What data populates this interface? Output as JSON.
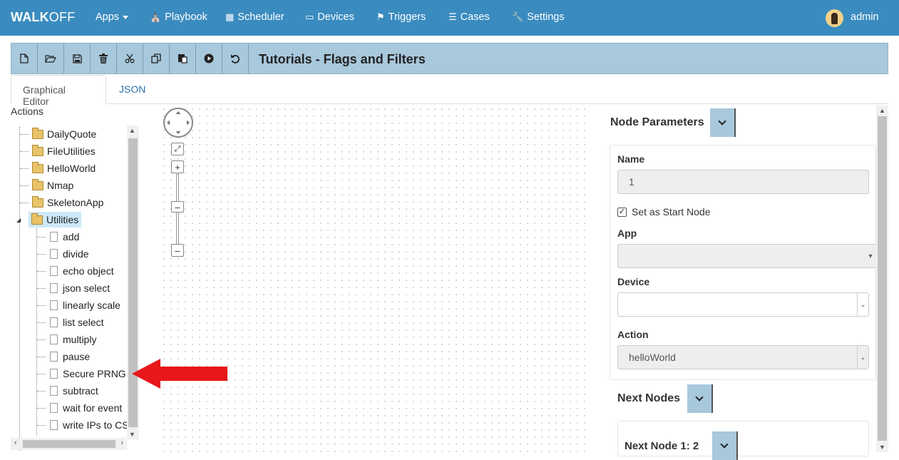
{
  "navbar": {
    "brand_bold": "WALK",
    "brand_rest": "OFF",
    "items": [
      {
        "label": "Apps",
        "icon": "caret-down-icon"
      },
      {
        "label": "Playbook",
        "icon": "sitemap-icon"
      },
      {
        "label": "Scheduler",
        "icon": "calendar-icon"
      },
      {
        "label": "Devices",
        "icon": "monitor-icon"
      },
      {
        "label": "Triggers",
        "icon": "flag-icon"
      },
      {
        "label": "Cases",
        "icon": "list-icon"
      },
      {
        "label": "Settings",
        "icon": "wrench-icon"
      }
    ],
    "user": "admin"
  },
  "toolbar": {
    "buttons": [
      {
        "name": "new",
        "icon": "new-file-icon"
      },
      {
        "name": "open",
        "icon": "folder-open-icon"
      },
      {
        "name": "save",
        "icon": "save-icon"
      },
      {
        "name": "delete",
        "icon": "trash-icon"
      },
      {
        "name": "cut",
        "icon": "scissors-icon"
      },
      {
        "name": "copy",
        "icon": "copy-icon"
      },
      {
        "name": "paste",
        "icon": "paste-icon"
      },
      {
        "name": "execute",
        "icon": "play-icon"
      },
      {
        "name": "undo",
        "icon": "undo-icon"
      }
    ],
    "title": "Tutorials - Flags and Filters"
  },
  "tabs": [
    {
      "label": "Graphical Editor",
      "active": true
    },
    {
      "label": "JSON",
      "active": false
    }
  ],
  "actions": {
    "label": "Actions",
    "apps": [
      "DailyQuote",
      "FileUtilities",
      "HelloWorld",
      "Nmap",
      "SkeletonApp",
      "Utilities"
    ],
    "selected_app": "Utilities",
    "utilities_actions": [
      "add",
      "divide",
      "echo object",
      "json select",
      "linearly scale",
      "list select",
      "multiply",
      "pause",
      "Secure PRNG",
      "subtract",
      "wait for event",
      "write IPs to CS"
    ]
  },
  "node_parameters": {
    "title": "Node Parameters",
    "name_label": "Name",
    "name_value": "1",
    "start_node_label": "Set as Start Node",
    "start_node_checked": true,
    "app_label": "App",
    "app_value": "",
    "device_label": "Device",
    "device_value": "",
    "action_label": "Action",
    "action_value": "helloWorld"
  },
  "next_nodes": {
    "title": "Next Nodes",
    "first_label": "Next Node 1: 2"
  },
  "colors": {
    "navbar": "#3a8bbf",
    "toolbar": "#a8c8dc",
    "annotation_arrow": "#e8171a"
  }
}
